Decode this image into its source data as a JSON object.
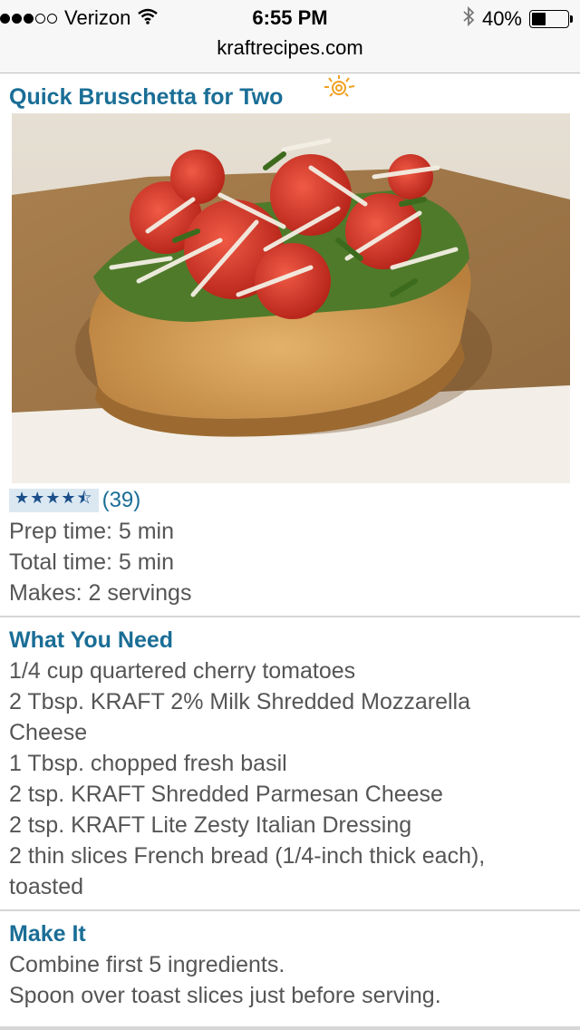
{
  "status": {
    "carrier": "Verizon",
    "time": "6:55 PM",
    "battery": "40%",
    "battery_level": 0.4,
    "signal_bars_filled": 3,
    "signal_bars_total": 5
  },
  "browser": {
    "url": "kraftrecipes.com"
  },
  "recipe": {
    "title": "Quick Bruschetta for Two",
    "rating_stars": "★★★★⯪",
    "rating_value": 4.5,
    "rating_count": "(39)",
    "prep_time": "Prep time: 5 min",
    "total_time": "Total time: 5 min",
    "makes": "Makes: 2 servings"
  },
  "what_you_need": {
    "heading": "What You Need",
    "lines": [
      "1/4 cup quartered cherry tomatoes",
      "2 Tbsp. KRAFT 2% Milk Shredded Mozzarella",
      "Cheese",
      "1 Tbsp. chopped fresh basil",
      "2 tsp. KRAFT Shredded Parmesan Cheese",
      "2 tsp. KRAFT Lite Zesty Italian Dressing",
      "2 thin slices French bread (1/4-inch thick each),",
      "toasted"
    ]
  },
  "make_it": {
    "heading": "Make It",
    "lines": [
      "Combine first 5 ingredients.",
      "Spoon over toast slices just before serving."
    ]
  },
  "colors": {
    "link_blue": "#1a6e96",
    "body_gray": "#555555",
    "star_blue": "#1a4f8a"
  }
}
